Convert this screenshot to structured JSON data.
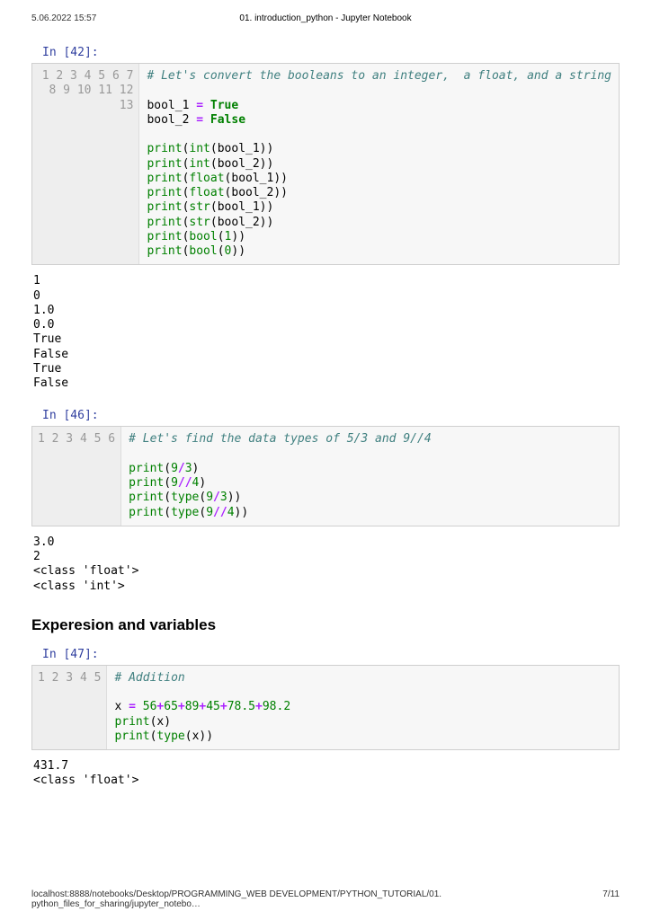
{
  "header": {
    "date": "5.06.2022 15:57",
    "title": "01. introduction_python - Jupyter Notebook"
  },
  "cells": [
    {
      "prompt": "In [42]:",
      "gutter": "1\n2\n3\n4\n5\n6\n7\n8\n9\n10\n11\n12\n13",
      "output": "1\n0\n1.0\n0.0\nTrue\nFalse\nTrue\nFalse"
    },
    {
      "prompt": "In [46]:",
      "gutter": "1\n2\n3\n4\n5\n6",
      "output": "3.0\n2\n<class 'float'>\n<class 'int'>"
    },
    {
      "prompt": "In [47]:",
      "gutter": "1\n2\n3\n4\n5",
      "output": "431.7\n<class 'float'>"
    }
  ],
  "section_heading": "Experesion and variables",
  "code42": {
    "comment": "# Let's convert the booleans to an integer,  a float, and a string",
    "l3a": "bool_1 ",
    "l3b": "=",
    "l3c": " True",
    "l4a": "bool_2 ",
    "l4b": "=",
    "l4c": " False",
    "print": "print",
    "int": "int",
    "float": "float",
    "str": "str",
    "bool": "bool",
    "b1": "(bool_1))",
    "b2": "(bool_2))",
    "n1": "1",
    "n0": "0",
    "lp": "(",
    "rp": "))",
    "rps": ")"
  },
  "code46": {
    "comment": "# Let's find the data types of 5/3 and 9//4",
    "print": "print",
    "type": "type",
    "n9": "9",
    "n3": "3",
    "n4": "4",
    "slash": "/",
    "dslash": "//",
    "lp": "(",
    "rp": ")",
    "rpp": "))"
  },
  "code47": {
    "comment": "# Addition",
    "xeq": "x ",
    "eq": "=",
    "nums": [
      " 56",
      "65",
      "89",
      "45",
      "78.5",
      "98.2"
    ],
    "plus": "+",
    "print": "print",
    "type": "type",
    "lp": "(",
    "rp": ")",
    "rpp": "))",
    "x": "x"
  },
  "footer": {
    "url": "localhost:8888/notebooks/Desktop/PROGRAMMING_WEB DEVELOPMENT/PYTHON_TUTORIAL/01. python_files_for_sharing/jupyter_notebo…",
    "page": "7/11"
  }
}
